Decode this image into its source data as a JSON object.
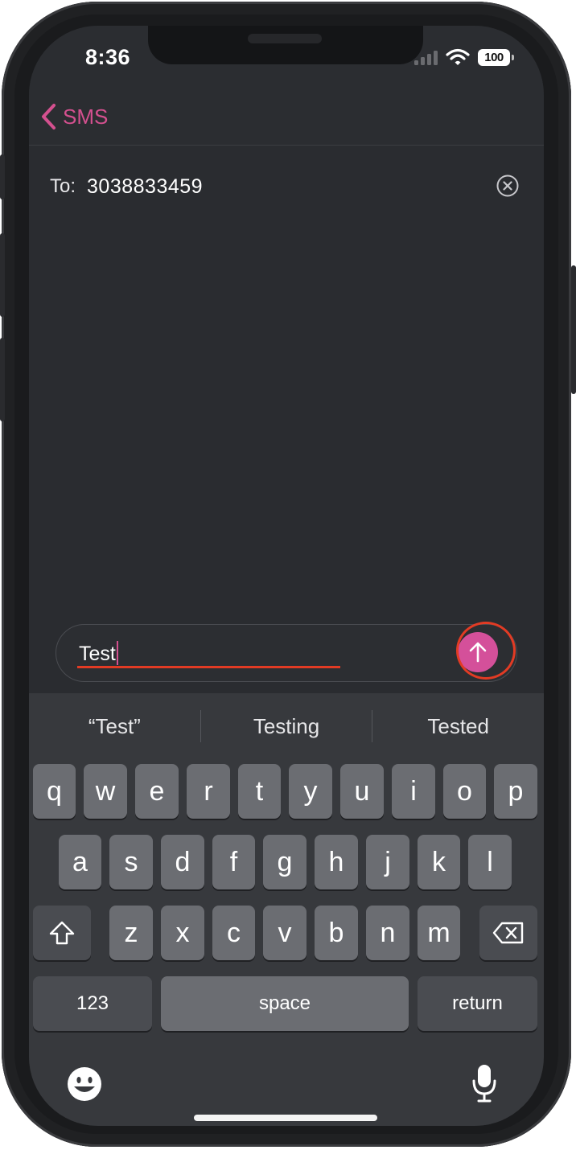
{
  "status_bar": {
    "time": "8:36",
    "battery": "100"
  },
  "nav": {
    "back_label": "SMS"
  },
  "recipient": {
    "label": "To:",
    "value": "3038833459"
  },
  "composer": {
    "text": "Test"
  },
  "keyboard": {
    "suggestions": [
      "“Test”",
      "Testing",
      "Tested"
    ],
    "row1": [
      "q",
      "w",
      "e",
      "r",
      "t",
      "y",
      "u",
      "i",
      "o",
      "p"
    ],
    "row2": [
      "a",
      "s",
      "d",
      "f",
      "g",
      "h",
      "j",
      "k",
      "l"
    ],
    "row3": [
      "z",
      "x",
      "c",
      "v",
      "b",
      "n",
      "m"
    ],
    "numbers_label": "123",
    "space_label": "space",
    "return_label": "return"
  },
  "colors": {
    "accent": "#d4509a",
    "highlight": "#e23b24"
  }
}
